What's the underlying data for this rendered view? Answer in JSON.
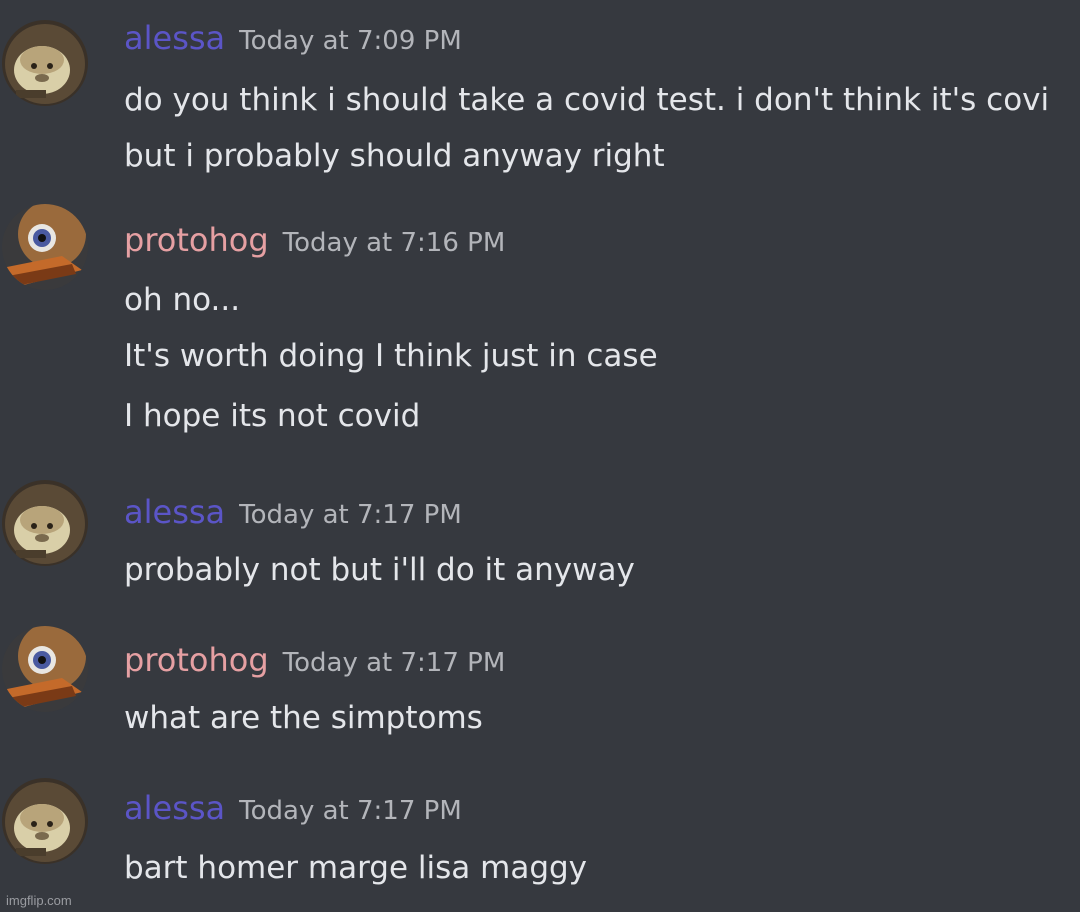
{
  "messages": [
    {
      "author": "alessa",
      "avatar": "monkey-avatar",
      "timestamp": "Today at 7:09 PM",
      "lines": [
        "do you think i should take a covid test. i don't think it's covi",
        "but i probably should anyway right"
      ]
    },
    {
      "author": "protohog",
      "avatar": "bird-avatar",
      "timestamp": "Today at 7:16 PM",
      "lines": [
        "oh no...",
        "It's worth doing I think just in case",
        "I hope its not covid"
      ]
    },
    {
      "author": "alessa",
      "avatar": "monkey-avatar",
      "timestamp": "Today at 7:17 PM",
      "lines": [
        "probably not but i'll do it anyway"
      ]
    },
    {
      "author": "protohog",
      "avatar": "bird-avatar",
      "timestamp": "Today at 7:17 PM",
      "lines": [
        "what are the simptoms"
      ]
    },
    {
      "author": "alessa",
      "avatar": "monkey-avatar",
      "timestamp": "Today at 7:17 PM",
      "lines": [
        "bart homer marge lisa maggy"
      ]
    }
  ],
  "colors": {
    "background": "#36393f",
    "alessa_name": "#5b55c7",
    "protohog_name": "#e6a0a3",
    "message_text": "#e4e6ea",
    "timestamp": "#b3b5ba"
  },
  "watermark": "imgflip.com"
}
